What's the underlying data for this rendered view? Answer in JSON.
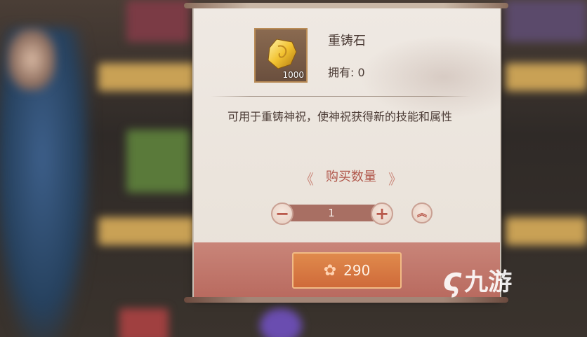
{
  "item": {
    "name": "重铸石",
    "owned_label": "拥有: 0",
    "slot_quantity": "1000",
    "icon": "golden-stone-icon"
  },
  "description": "可用于重铸神祝，使神祝获得新的技能和属性",
  "purchase": {
    "title": "购买数量",
    "quantity": "1",
    "decrease_icon": "minus-icon",
    "increase_icon": "plus-icon",
    "max_icon": "double-chevron-up-icon",
    "price": "290",
    "currency_icon": "flower-icon"
  },
  "watermark": {
    "text": "九游"
  },
  "colors": {
    "panel_bg": "#ece5dd",
    "accent_red": "#b0564a",
    "buy_button": "#d8763f",
    "bottom_band": "#c07266"
  }
}
